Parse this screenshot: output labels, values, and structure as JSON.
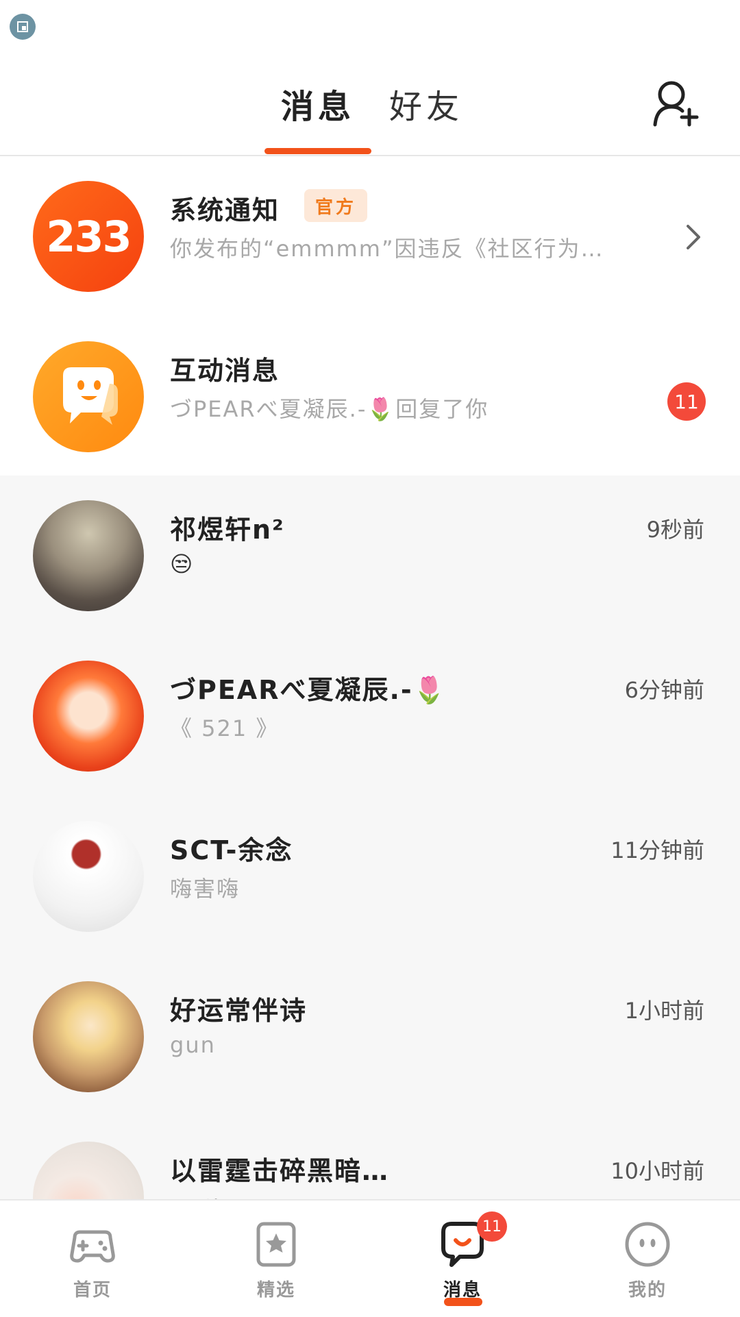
{
  "header": {
    "tabs": [
      {
        "label": "消息",
        "active": true
      },
      {
        "label": "好友",
        "active": false
      }
    ],
    "add_friend_icon": "add-user-icon"
  },
  "official": [
    {
      "title": "系统通知",
      "badge": "官方",
      "preview": "你发布的“emmmm”因违反《社区行为…",
      "avatar_text": "233",
      "trailing_icon": "chevron-right-icon"
    },
    {
      "title": "互动消息",
      "preview": "づPEARべ夏凝辰.-🌷回复了你",
      "avatar_icon": "chat-face-icon",
      "unread": "11"
    }
  ],
  "conversations": [
    {
      "name": "祁煜轩n²",
      "preview": "😒",
      "time": "9秒前"
    },
    {
      "name": "づPEARべ夏凝辰.-🌷",
      "preview": "《 521 》",
      "time": "6分钟前"
    },
    {
      "name": "SCT-余念",
      "preview": "嗨害嗨",
      "time": "11分钟前"
    },
    {
      "name": "好运常伴诗",
      "preview": "gun",
      "time": "1小时前"
    },
    {
      "name": "以雷霆击碎黑暗…",
      "preview": "[图片]",
      "time": "10小时前"
    }
  ],
  "nav": {
    "items": [
      {
        "label": "首页",
        "icon": "gamepad-icon"
      },
      {
        "label": "精选",
        "icon": "star-icon"
      },
      {
        "label": "消息",
        "icon": "message-icon",
        "badge": "11",
        "active": true
      },
      {
        "label": "我的",
        "icon": "profile-face-icon"
      }
    ]
  },
  "colors": {
    "accent": "#f2521a",
    "badge": "#f34a3a",
    "official_badge_bg": "#fde8d8",
    "official_badge_text": "#f07a1c"
  }
}
